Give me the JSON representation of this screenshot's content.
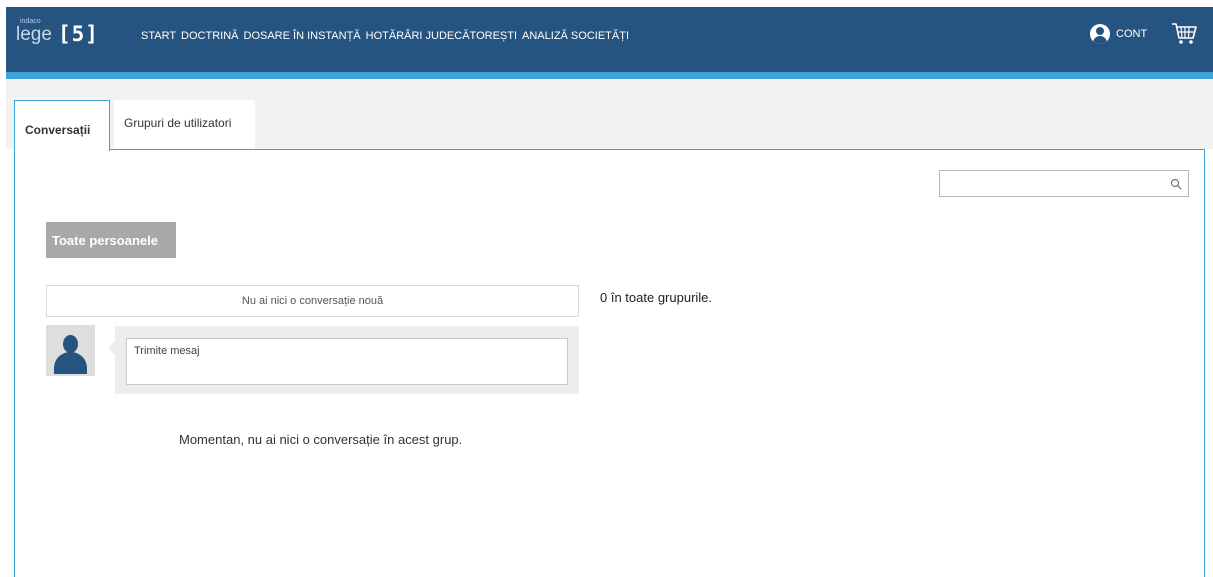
{
  "brand": {
    "small": "indaco",
    "name": "lege",
    "number": "[5]"
  },
  "nav": [
    {
      "label": "START"
    },
    {
      "label": "DOCTRINĂ"
    },
    {
      "label": "DOSARE ÎN INSTANȚĂ"
    },
    {
      "label": "HOTĂRÂRI JUDECĂTOREȘTI"
    },
    {
      "label": "ANALIZĂ SOCIETĂȚI"
    }
  ],
  "account": {
    "label": "CONT"
  },
  "tabs": [
    {
      "label": "Conversații",
      "active": true
    },
    {
      "label": "Grupuri de utilizatori",
      "active": false
    }
  ],
  "search": {
    "placeholder": "",
    "value": ""
  },
  "filter": {
    "label": "Toate persoanele"
  },
  "notice": {
    "text": "Nu ai nici o conversație nouă"
  },
  "summary": {
    "text": "0 în toate grupurile."
  },
  "compose": {
    "placeholder": "Trimite mesaj"
  },
  "empty": {
    "text": "Momentan, nu ai nici o conversație în acest grup."
  },
  "colors": {
    "header": "#265480",
    "accent": "#3ea3d8",
    "filter_button": "#a8a8a8"
  },
  "icons": [
    "user-circle-icon",
    "cart-icon",
    "search-icon",
    "avatar-icon"
  ]
}
